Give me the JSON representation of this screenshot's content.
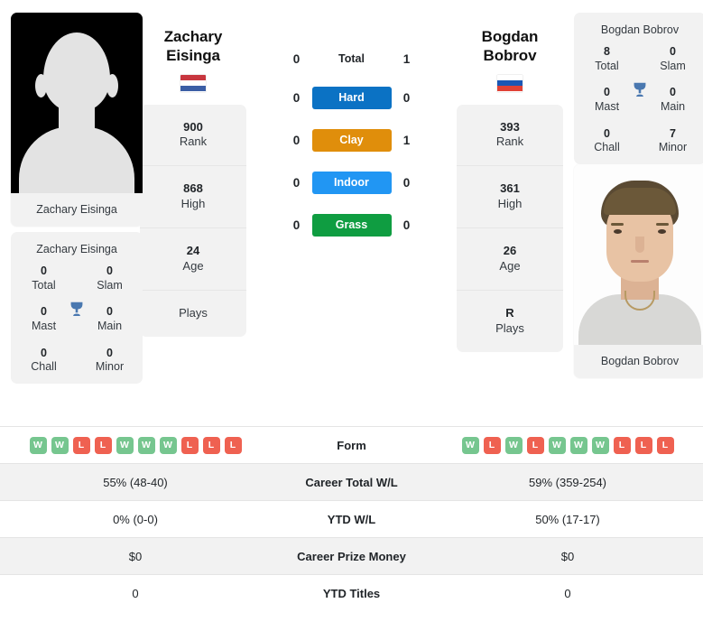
{
  "players": {
    "left": {
      "name_line1": "Zachary",
      "name_line2": "Eisinga",
      "full_name": "Zachary Eisinga",
      "photo_caption": "Zachary Eisinga",
      "photo_type": "placeholder-silhouette",
      "flag_country": "Netherlands",
      "flag_colors": [
        "#c8363f",
        "#ffffff",
        "#3b5ea5"
      ],
      "stats": [
        {
          "value": "900",
          "label": "Rank"
        },
        {
          "value": "868",
          "label": "High"
        },
        {
          "value": "24",
          "label": "Age"
        },
        {
          "value": "",
          "label": "Plays"
        }
      ],
      "titles_heading": "Zachary Eisinga",
      "titles": [
        {
          "value": "0",
          "label": "Total"
        },
        {
          "value": "0",
          "label": "Slam"
        },
        {
          "value": "0",
          "label": "Mast"
        },
        {
          "value": "0",
          "label": "Main"
        },
        {
          "value": "0",
          "label": "Chall"
        },
        {
          "value": "0",
          "label": "Minor"
        }
      ],
      "form": [
        "W",
        "W",
        "L",
        "L",
        "W",
        "W",
        "W",
        "L",
        "L",
        "L"
      ],
      "career_total_wl": "55% (48-40)",
      "ytd_wl": "0% (0-0)",
      "career_prize_money": "$0",
      "ytd_titles": "0"
    },
    "right": {
      "name_line1": "Bogdan",
      "name_line2": "Bobrov",
      "full_name": "Bogdan Bobrov",
      "photo_caption": "Bogdan Bobrov",
      "photo_type": "photograph",
      "flag_country": "Russia",
      "flag_colors": [
        "#ffffff",
        "#1b57b5",
        "#e04236"
      ],
      "stats": [
        {
          "value": "393",
          "label": "Rank"
        },
        {
          "value": "361",
          "label": "High"
        },
        {
          "value": "26",
          "label": "Age"
        },
        {
          "value": "R",
          "label": "Plays"
        }
      ],
      "titles_heading": "Bogdan Bobrov",
      "titles": [
        {
          "value": "8",
          "label": "Total"
        },
        {
          "value": "0",
          "label": "Slam"
        },
        {
          "value": "0",
          "label": "Mast"
        },
        {
          "value": "0",
          "label": "Main"
        },
        {
          "value": "0",
          "label": "Chall"
        },
        {
          "value": "7",
          "label": "Minor"
        }
      ],
      "form": [
        "W",
        "L",
        "W",
        "L",
        "W",
        "W",
        "W",
        "L",
        "L",
        "L"
      ],
      "career_total_wl": "59% (359-254)",
      "ytd_wl": "50% (17-17)",
      "career_prize_money": "$0",
      "ytd_titles": "0"
    }
  },
  "h2h": [
    {
      "label": "Total",
      "left": "0",
      "right": "1",
      "style": "plain",
      "color": ""
    },
    {
      "label": "Hard",
      "left": "0",
      "right": "0",
      "style": "pill",
      "color": "#0b72c4"
    },
    {
      "label": "Clay",
      "left": "0",
      "right": "1",
      "style": "pill",
      "color": "#e08e0b"
    },
    {
      "label": "Indoor",
      "left": "0",
      "right": "0",
      "style": "pill",
      "color": "#2196f3"
    },
    {
      "label": "Grass",
      "left": "0",
      "right": "0",
      "style": "pill",
      "color": "#0f9d41"
    }
  ],
  "comparison_rows": [
    {
      "label": "Form",
      "left": "",
      "right": "",
      "type": "form",
      "alt": false
    },
    {
      "label": "Career Total W/L",
      "left": "55% (48-40)",
      "right": "59% (359-254)",
      "type": "text",
      "alt": true
    },
    {
      "label": "YTD W/L",
      "left": "0% (0-0)",
      "right": "50% (17-17)",
      "type": "text",
      "alt": false
    },
    {
      "label": "Career Prize Money",
      "left": "$0",
      "right": "$0",
      "type": "text",
      "alt": true
    },
    {
      "label": "YTD Titles",
      "left": "0",
      "right": "0",
      "type": "text",
      "alt": false
    }
  ],
  "icons": {
    "trophy": "trophy-icon",
    "trophy_color": "#4a78b0"
  },
  "colors": {
    "card_bg": "#f2f2f2",
    "win_badge": "#76c68f",
    "loss_badge": "#ef6151"
  }
}
